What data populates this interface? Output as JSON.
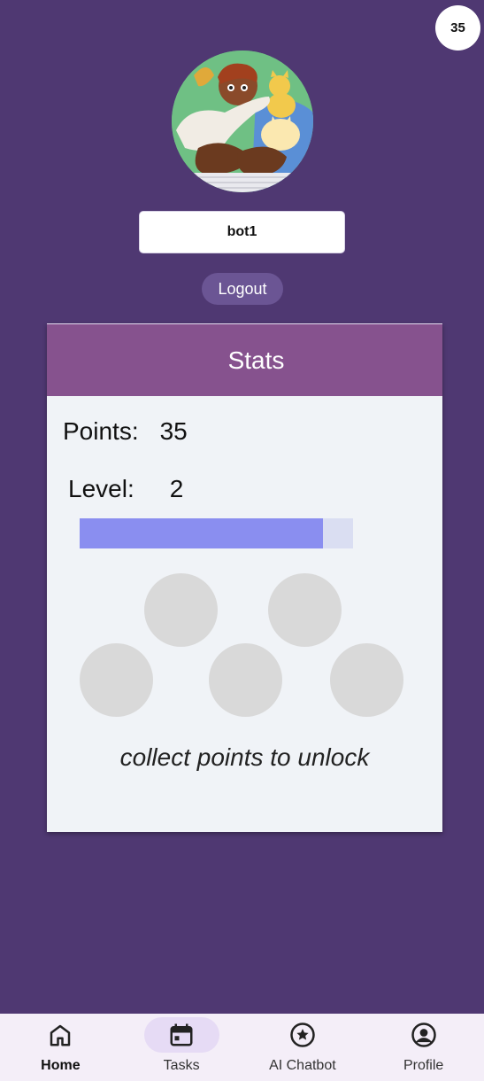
{
  "header": {
    "points_badge": "35"
  },
  "profile": {
    "username": "bot1",
    "logout_label": "Logout"
  },
  "stats": {
    "title": "Stats",
    "points_label": "Points:",
    "points_value": "35",
    "level_label": "Level:",
    "level_value": "2",
    "progress_fraction": 0.89,
    "unlock_text": "collect points to unlock"
  },
  "nav": {
    "items": [
      {
        "label": "Home",
        "icon": "home-icon",
        "active": true
      },
      {
        "label": "Tasks",
        "icon": "calendar-icon",
        "active": false
      },
      {
        "label": "AI Chatbot",
        "icon": "star-circle-icon",
        "active": false
      },
      {
        "label": "Profile",
        "icon": "account-circle-icon",
        "active": false
      }
    ]
  },
  "colors": {
    "background": "#4f3872",
    "stats_header": "#86528e",
    "progress_fill": "#8a8ef0",
    "nav_pill": "#e6dbf5"
  }
}
